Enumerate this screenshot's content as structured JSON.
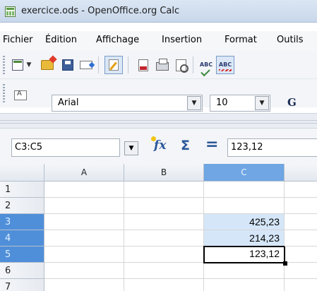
{
  "window": {
    "title": "exercice.ods - OpenOffice.org Calc"
  },
  "menu": [
    "Fichier",
    "Édition",
    "Affichage",
    "Insertion",
    "Format",
    "Outils"
  ],
  "toolbar": {
    "icons": [
      "new-document-icon",
      "dropdown-arrow-icon",
      "open-folder-icon",
      "save-icon",
      "email-icon",
      "edit-mode-icon",
      "export-pdf-icon",
      "print-icon",
      "page-preview-icon",
      "spellcheck-icon",
      "autospellcheck-icon"
    ]
  },
  "format_bar": {
    "font_name": "Arial",
    "font_size": "10",
    "bold_label": "G"
  },
  "formula_bar": {
    "name_box": "C3:C5",
    "input_value": "123,12",
    "function_wizard_label": "fx",
    "sum_label": "Σ",
    "equals_label": "="
  },
  "sheet": {
    "columns": [
      "A",
      "B",
      "C"
    ],
    "rows": [
      "1",
      "2",
      "3",
      "4",
      "5",
      "6",
      "7"
    ],
    "selected_column": "C",
    "selected_rows": [
      "3",
      "4",
      "5"
    ],
    "cells": {
      "C3": "425,23",
      "C4": "214,23",
      "C5": "123,12"
    },
    "active_cell": "C5"
  },
  "colors": {
    "selection_header": "#4f8fd9",
    "selection_fill": "#d5e6f8",
    "accent": "#2b5799"
  }
}
